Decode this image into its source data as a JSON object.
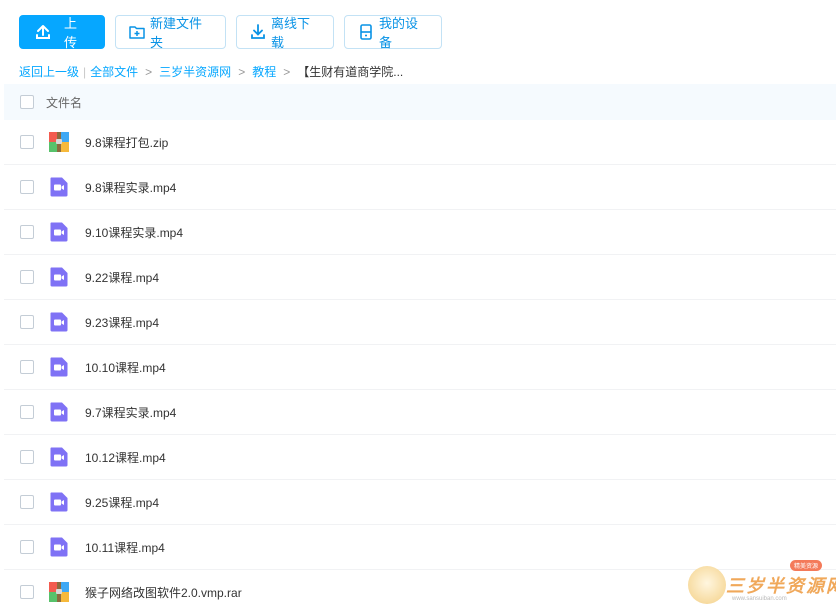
{
  "toolbar": {
    "upload_label": "上传",
    "new_folder_label": "新建文件夹",
    "offline_download_label": "离线下载",
    "my_devices_label": "我的设备"
  },
  "breadcrumb": {
    "back_label": "返回上一级",
    "all_files_label": "全部文件",
    "crumb_1": "三岁半资源网",
    "crumb_2": "教程",
    "current": "【生财有道商学院..."
  },
  "list": {
    "header_name": "文件名",
    "files": [
      {
        "name": "9.8课程打包.zip",
        "type": "zip"
      },
      {
        "name": "9.8课程实录.mp4",
        "type": "video"
      },
      {
        "name": "9.10课程实录.mp4",
        "type": "video"
      },
      {
        "name": "9.22课程.mp4",
        "type": "video"
      },
      {
        "name": "9.23课程.mp4",
        "type": "video"
      },
      {
        "name": "10.10课程.mp4",
        "type": "video"
      },
      {
        "name": "9.7课程实录.mp4",
        "type": "video"
      },
      {
        "name": "10.12课程.mp4",
        "type": "video"
      },
      {
        "name": "9.25课程.mp4",
        "type": "video"
      },
      {
        "name": "10.11课程.mp4",
        "type": "video"
      },
      {
        "name": "猴子网络改图软件2.0.vmp.rar",
        "type": "zip"
      }
    ]
  },
  "watermark": {
    "text": "三岁半资源网",
    "url": "www.sansuiban.com",
    "badge": "精美资源"
  },
  "colors": {
    "accent": "#06a7ff",
    "video_icon": "#7f72f5",
    "header_bg": "#f5fafe"
  }
}
